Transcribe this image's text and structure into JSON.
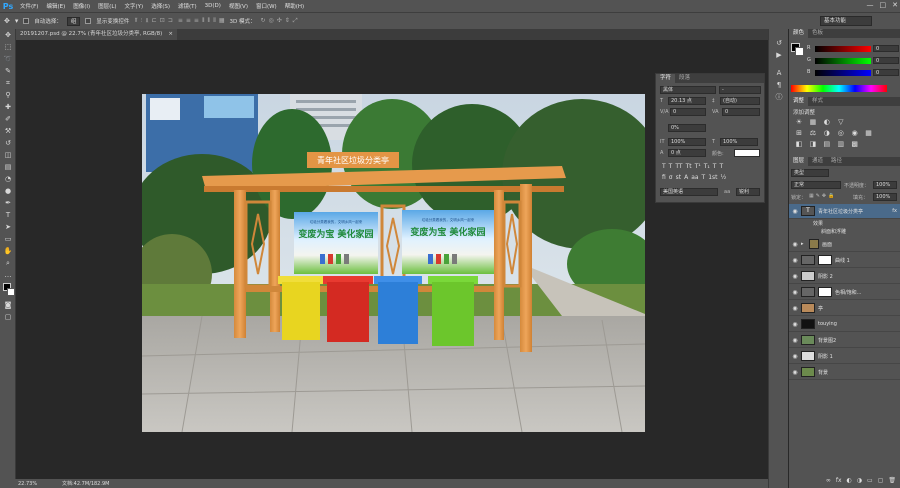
{
  "app": {
    "logo": "Ps"
  },
  "menu": [
    "文件(F)",
    "编辑(E)",
    "图像(I)",
    "图层(L)",
    "文字(Y)",
    "选择(S)",
    "滤镜(T)",
    "3D(D)",
    "视图(V)",
    "窗口(W)",
    "帮助(H)"
  ],
  "window_controls": [
    "—",
    "□",
    "✕"
  ],
  "options": {
    "auto_select_label": "自动选择：",
    "auto_select_value": "组",
    "show_transform_label": "显示变换控件",
    "mode_3d_label": "3D 模式：",
    "workspace": "基本功能"
  },
  "document_tab": {
    "title": "20191207.psd @ 22.7% (青年社区垃圾分类亭, RGB/8)",
    "close": "×"
  },
  "status": {
    "zoom": "22.73%",
    "doc_size": "文档:42.7M/182.9M"
  },
  "character_panel": {
    "tabs": [
      "字符",
      "段落"
    ],
    "font_family": "黑体",
    "font_style": "-",
    "font_size": "20.13 点",
    "leading": "(自动)",
    "kerning": "0",
    "tracking": "0",
    "tsume": "0%",
    "vertical_scale": "100%",
    "horizontal_scale": "100%",
    "baseline_shift": "0 点",
    "color_label": "颜色:",
    "text_buttons_1": [
      "T",
      "T",
      "TT",
      "Tt",
      "T¹",
      "T₁",
      "T",
      "T"
    ],
    "text_buttons_2": [
      "fi",
      "σ",
      "st",
      "A",
      "aa",
      "T",
      "1st",
      "½"
    ],
    "language": "美国英语",
    "antialias_label": "aa",
    "antialias": "锐利"
  },
  "color_panel": {
    "tabs": [
      "颜色",
      "色板"
    ],
    "sliders": [
      {
        "label": "R",
        "value": "0",
        "color": "#ff0000"
      },
      {
        "label": "G",
        "value": "0",
        "color": "#00ff00"
      },
      {
        "label": "B",
        "value": "0",
        "color": "#0000ff"
      }
    ]
  },
  "adjustments_panel": {
    "tabs": [
      "调整",
      "样式"
    ],
    "title": "添加调整",
    "icons_row1": [
      "☀",
      "▦",
      "◐",
      "▽"
    ],
    "icons_row2": [
      "⊞",
      "⚖",
      "◑",
      "◎",
      "◉",
      "▦"
    ],
    "icons_row3": [
      "◧",
      "◨",
      "▤",
      "▥",
      "▩"
    ]
  },
  "layers_panel": {
    "tabs": [
      "图层",
      "通道",
      "路径"
    ],
    "kind_filter": "类型",
    "blend_mode": "正常",
    "opacity_label": "不透明度：",
    "opacity": "100%",
    "lock_label": "锁定：",
    "fill_label": "填充：",
    "fill": "100%",
    "layers": [
      {
        "name": "青年社区垃圾分类亭",
        "type": "text",
        "selected": true,
        "fx": "fx"
      },
      {
        "name": "效果",
        "type": "effect-group"
      },
      {
        "name": "斜面和浮雕",
        "type": "effect"
      },
      {
        "name": "画面",
        "type": "group"
      },
      {
        "name": "曲线 1",
        "type": "adjustment"
      },
      {
        "name": "阴影 2",
        "type": "layer"
      },
      {
        "name": "色相/饱和...",
        "type": "adjustment"
      },
      {
        "name": "亭",
        "type": "layer"
      },
      {
        "name": "touying",
        "type": "layer"
      },
      {
        "name": "背景图2",
        "type": "layer"
      },
      {
        "name": "阴影 1",
        "type": "layer"
      },
      {
        "name": "背景",
        "type": "layer"
      }
    ],
    "footer_icons": [
      "∞",
      "fx",
      "◐",
      "◑",
      "▭",
      "▢",
      "🗑"
    ]
  },
  "scene": {
    "sign_text": "青年社区垃圾分类亭",
    "poster_headline": "变废为宝 美化家园",
    "poster_subline": "垃圾分类看我的，文明乡风一起来",
    "bin_colors": [
      "#e8d520",
      "#d42a22",
      "#2d7fd8",
      "#6cc62c"
    ]
  }
}
